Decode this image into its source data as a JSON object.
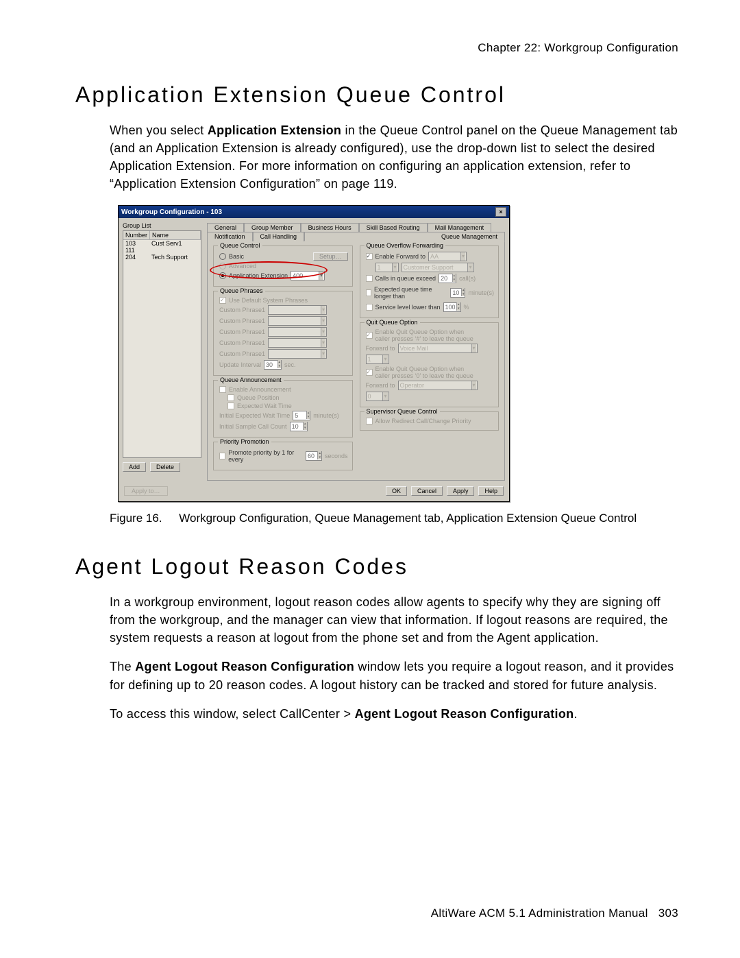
{
  "chapter_header": "Chapter 22:  Workgroup Configuration",
  "h1a": "Application Extension Queue Control",
  "para1_pre": "When you select ",
  "para1_bold": "Application Extension",
  "para1_post": " in the Queue Control panel on the Queue Management tab (and an Application Extension is already configured), use the drop-down list to select the desired Application Extension. For more information on configuring an application extension, refer to “Application Extension Configuration” on page 119.",
  "caption_label": "Figure 16.",
  "caption_text": "Workgroup Configuration, Queue Management tab, Application Extension Queue Control",
  "h1b": "Agent Logout Reason Codes",
  "para2": "In a workgroup environment, logout reason codes allow agents to specify why they are signing off from the workgroup, and the manager can view that information. If logout reasons are required, the system requests a reason at logout from the phone set and from the Agent application.",
  "para3_pre": "The ",
  "para3_bold": "Agent Logout Reason Configuration",
  "para3_post": " window lets you require a logout reason, and it provides for defining up to 20 reason codes. A logout history can be tracked and stored for future analysis.",
  "para4_pre": "To access this window, select CallCenter > ",
  "para4_bold": "Agent Logout Reason Configuration",
  "para4_post": ".",
  "footer_text": "AltiWare ACM 5.1 Administration Manual",
  "footer_page": "303",
  "dlg": {
    "title": "Workgroup Configuration - 103",
    "grouplist_label": "Group List",
    "col_number": "Number",
    "col_name": "Name",
    "rows": [
      {
        "num": "103",
        "name": "Cust Serv1"
      },
      {
        "num": "111",
        "name": ""
      },
      {
        "num": "204",
        "name": "Tech Support"
      }
    ],
    "add": "Add",
    "delete": "Delete",
    "apply_to": "Apply to…",
    "tabs_row1": [
      "General",
      "Group Member",
      "Business Hours",
      "Skill Based Routing",
      "Mail Management"
    ],
    "tabs_row2": [
      "Notification",
      "Call Handling",
      "Queue Management"
    ],
    "qc": {
      "title": "Queue Control",
      "basic": "Basic",
      "advanced": "Advanced",
      "appext": "Application Extension",
      "appext_val": "400",
      "setup": "Setup…"
    },
    "qp": {
      "title": "Queue Phrases",
      "use_default": "Use Default System Phrases",
      "custom": "Custom Phrase1",
      "interval": "Update Interval",
      "interval_val": "30",
      "interval_unit": "sec."
    },
    "qa": {
      "title": "Queue Announcement",
      "enable": "Enable Announcement",
      "qpos": "Queue Position",
      "ewt": "Expected Wait Time",
      "iewt": "Initial Expected Wait Time",
      "iewt_val": "5",
      "iewt_unit": "minute(s)",
      "iscc": "Initial Sample Call Count",
      "iscc_val": "10"
    },
    "pp": {
      "title": "Priority Promotion",
      "label": "Promote priority by 1 for every",
      "val": "60",
      "unit": "seconds"
    },
    "qof": {
      "title": "Queue Overflow Forwarding",
      "enable_fwd": "Enable Forward to",
      "aa": "AA",
      "dest_num": "1",
      "dest_name": "Customer Support",
      "calls_exceed": "Calls in queue exceed",
      "calls_val": "20",
      "calls_unit": "call(s)",
      "ewt_longer": "Expected queue time longer than",
      "ewt_val": "10",
      "ewt_unit": "minute(s)",
      "slvl": "Service level lower than",
      "slvl_val": "100",
      "slvl_unit": "%"
    },
    "quit": {
      "title": "Quit Queue Option",
      "opt1": "Enable Quit Queue Option when caller presses ‘#’ to leave the queue",
      "fwd_to": "Forward to",
      "vm": "Voice Mail",
      "num1": "1",
      "opt2": "Enable Quit Queue Option when caller presses ‘0’ to leave the queue",
      "op": "Operator",
      "num2": "0"
    },
    "sqc": {
      "title": "Supervisor Queue Control",
      "allow": "Allow Redirect Call/Change Priority"
    },
    "ok": "OK",
    "cancel": "Cancel",
    "apply": "Apply",
    "help": "Help"
  }
}
